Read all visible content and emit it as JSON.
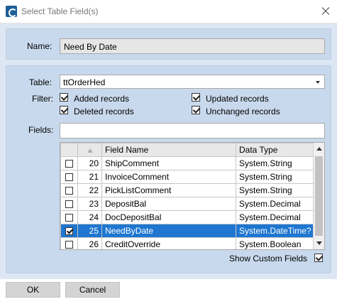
{
  "window": {
    "title": "Select Table Field(s)"
  },
  "name": {
    "label": "Name:",
    "value": "Need By Date"
  },
  "table": {
    "label": "Table:",
    "value": "ttOrderHed"
  },
  "filter": {
    "label": "Filter:",
    "added": {
      "label": "Added records",
      "checked": true
    },
    "updated": {
      "label": "Updated records",
      "checked": true
    },
    "deleted": {
      "label": "Deleted records",
      "checked": true
    },
    "unchanged": {
      "label": "Unchanged records",
      "checked": true
    }
  },
  "fields": {
    "label": "Fields:",
    "value": ""
  },
  "grid": {
    "headers": {
      "field_name": "Field Name",
      "data_type": "Data Type"
    },
    "rows": [
      {
        "num": "20",
        "field": "ShipComment",
        "type": "System.String",
        "checked": false
      },
      {
        "num": "21",
        "field": "InvoiceComment",
        "type": "System.String",
        "checked": false
      },
      {
        "num": "22",
        "field": "PickListComment",
        "type": "System.String",
        "checked": false
      },
      {
        "num": "23",
        "field": "DepositBal",
        "type": "System.Decimal",
        "checked": false
      },
      {
        "num": "24",
        "field": "DocDepositBal",
        "type": "System.Decimal",
        "checked": false
      },
      {
        "num": "25",
        "field": "NeedByDate",
        "type": "System.DateTime?",
        "checked": true,
        "selected": true
      },
      {
        "num": "26",
        "field": "CreditOverride",
        "type": "System.Boolean",
        "checked": false
      }
    ]
  },
  "show_custom_fields": {
    "label": "Show Custom Fields",
    "checked": true
  },
  "buttons": {
    "ok": "OK",
    "cancel": "Cancel"
  },
  "colors": {
    "accent": "#1e76d0",
    "panel": "#c9d9ed",
    "background": "#dde7f3"
  }
}
